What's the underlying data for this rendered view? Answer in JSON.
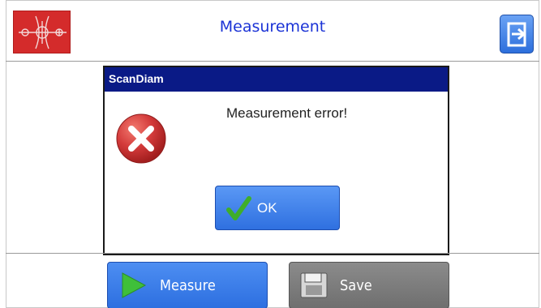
{
  "header": {
    "title": "Measurement",
    "logo_icon": "scan-diameter-logo-icon",
    "exit_icon": "exit-door-icon"
  },
  "dialog": {
    "title": "ScanDiam",
    "message": "Measurement error!",
    "icon": "error-x-icon",
    "ok_label": "OK",
    "ok_icon": "checkmark-icon"
  },
  "footer": {
    "measure_label": "Measure",
    "measure_icon": "play-icon",
    "save_label": "Save",
    "save_icon": "floppy-disk-icon"
  },
  "colors": {
    "title_text": "#1b33d6",
    "dialog_title_bar": "#0a1a86",
    "primary_button": "#3a7ce8",
    "disabled_button": "#7c7c7c",
    "logo_bg": "#d42b2b",
    "error_icon": "#d33a3a"
  }
}
